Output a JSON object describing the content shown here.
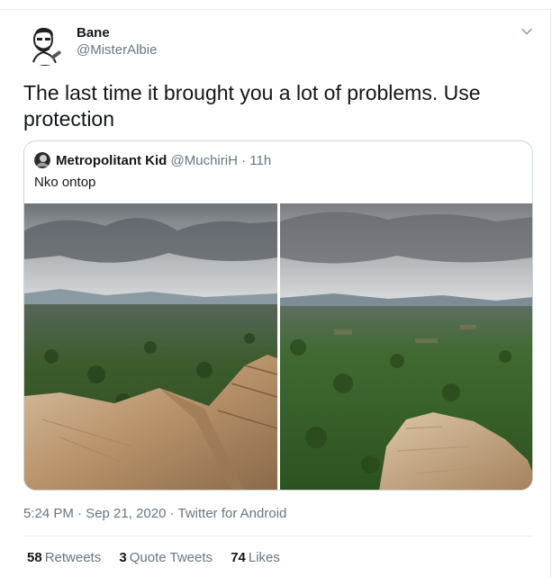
{
  "tweet": {
    "author_name": "Bane",
    "author_handle": "@MisterAlbie",
    "text": "The last time it brought you a lot of problems. Use protection",
    "timestamp": "5:24 PM · Sep 21, 2020 · Twitter for Android",
    "more_icon": "chevron-down-icon",
    "stats": [
      {
        "count": "58",
        "label": "Retweets"
      },
      {
        "count": "3",
        "label": "Quote Tweets"
      },
      {
        "count": "74",
        "label": "Likes"
      }
    ]
  },
  "quoted_tweet": {
    "author_name": "Metropolitant Kid",
    "author_handle": "@MuchiriH",
    "separator": "·",
    "age": "11h",
    "text": "Nko ontop",
    "images": [
      "landscape-photo-1",
      "landscape-photo-2"
    ]
  },
  "colors": {
    "text_primary": "#14171a",
    "text_secondary": "#657786",
    "border": "#e6ecf0",
    "quote_border": "#ccd6dd"
  }
}
